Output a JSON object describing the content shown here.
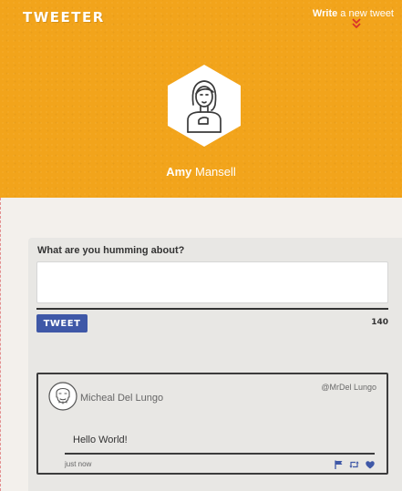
{
  "app": {
    "logo": "TWEETER"
  },
  "nav": {
    "write_bold": "Write",
    "write_rest": " a new tweet"
  },
  "profile": {
    "first_name": "Amy",
    "last_name": " Mansell"
  },
  "compose": {
    "label": "What are you humming about?",
    "value": "",
    "button_label": "TWEET",
    "char_count": "140"
  },
  "tweets": [
    {
      "author_name": "Micheal Del Lungo",
      "handle": "@MrDel Lungo",
      "body": "Hello World!",
      "time": "just now",
      "actions": [
        "flag-icon",
        "retweet-icon",
        "heart-icon"
      ]
    }
  ],
  "colors": {
    "header_bg": "#f2a41b",
    "page_bg": "#f3f0ec",
    "card_bg": "#e8e7e4",
    "button_bg": "#3f58a7",
    "chevron": "#d9342b",
    "action_icons": "#3f58a7"
  },
  "icons": {
    "write_chevrons": "double-chevron-down-icon",
    "profile_avatar": "user-avatar-hexagon",
    "tweet_avatar": "bearded-man-avatar"
  }
}
